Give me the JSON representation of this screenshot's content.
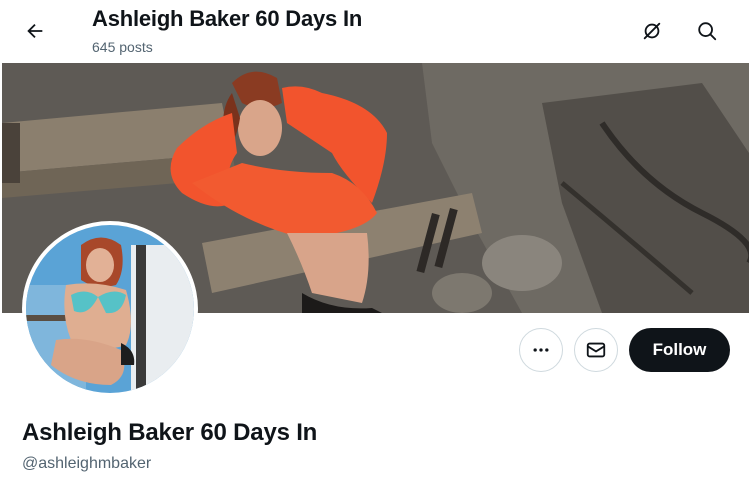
{
  "header": {
    "title": "Ashleigh Baker 60 Days In",
    "post_count": "645 posts",
    "back_icon": "arrow-left-icon",
    "grok_icon": "grok-icon",
    "search_icon": "search-icon"
  },
  "profile": {
    "display_name": "Ashleigh Baker 60 Days In",
    "handle": "@ashleighmbaker"
  },
  "actions": {
    "more_icon": "more-icon",
    "message_icon": "mail-icon",
    "follow_label": "Follow"
  },
  "colors": {
    "text_primary": "#0f1419",
    "text_secondary": "#536471",
    "follow_bg": "#0f1419",
    "border": "#cfd9de"
  }
}
